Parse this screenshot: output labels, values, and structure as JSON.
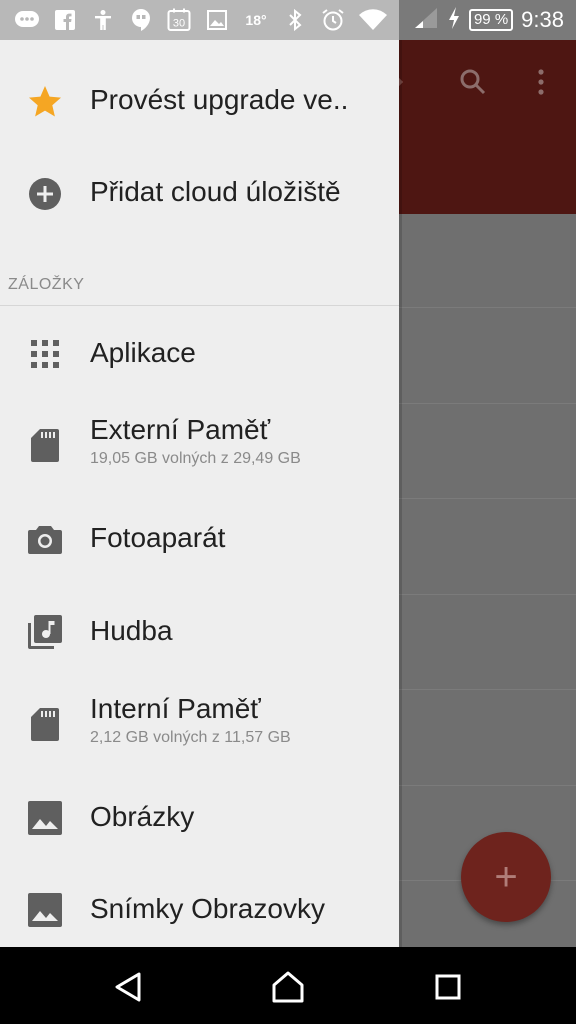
{
  "status_bar": {
    "battery": "99 %",
    "time": "9:38",
    "temperature": "18°",
    "calendar_day": "30",
    "icons": [
      "messenger-icon",
      "facebook-icon",
      "accessibility-icon",
      "hangouts-icon",
      "calendar-icon",
      "image-icon",
      "weather-icon",
      "bluetooth-icon",
      "alarm-icon",
      "wifi-icon",
      "signal-icon",
      "charging-icon"
    ]
  },
  "drawer": {
    "top_items": [
      {
        "label": "Provést upgrade ve..",
        "icon": "star-icon",
        "icon_color": "#f5a623"
      },
      {
        "label": "Přidat cloud úložiště",
        "icon": "add-circle-icon"
      }
    ],
    "section_title": "ZÁLOŽKY",
    "bookmarks": [
      {
        "label": "Aplikace",
        "icon": "apps-grid-icon"
      },
      {
        "label": "Externí Paměť",
        "subtitle": "19,05 GB volných z 29,49 GB",
        "icon": "sd-card-icon"
      },
      {
        "label": "Fotoaparát",
        "icon": "camera-icon"
      },
      {
        "label": "Hudba",
        "icon": "music-library-icon"
      },
      {
        "label": "Interní Paměť",
        "subtitle": "2,12 GB volných z 11,57 GB",
        "icon": "sd-card-icon"
      },
      {
        "label": "Obrázky",
        "icon": "image-icon"
      },
      {
        "label": "Snímky Obrazovky",
        "icon": "image-icon"
      }
    ]
  },
  "background_app": {
    "appbar_color": "#4e1612",
    "fab_label": "+",
    "actions": [
      "search-icon",
      "more-vert-icon"
    ]
  }
}
